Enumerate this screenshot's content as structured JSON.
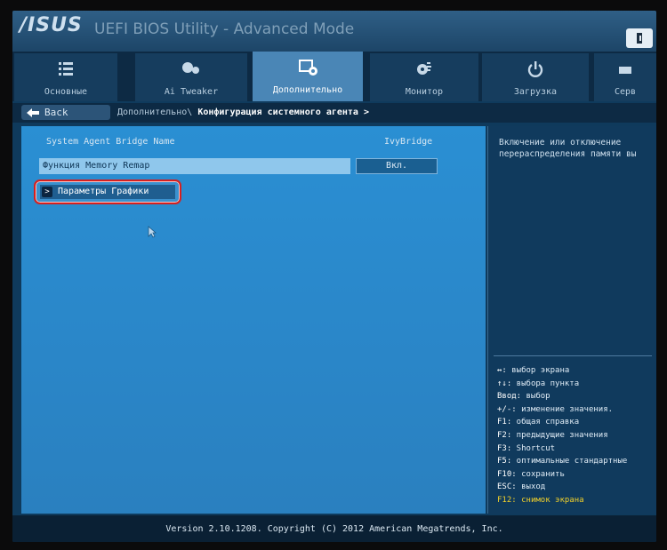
{
  "header": {
    "logo": "/ISUS",
    "title": "UEFI BIOS Utility - Advanced Mode"
  },
  "tabs": [
    {
      "label": "Основные",
      "icon": "list-icon",
      "active": false
    },
    {
      "label": "Ai Tweaker",
      "icon": "tweaker-icon",
      "active": false
    },
    {
      "label": "Дополнительно",
      "icon": "advanced-icon",
      "active": true
    },
    {
      "label": "Монитор",
      "icon": "monitor-icon",
      "active": false
    },
    {
      "label": "Загрузка",
      "icon": "power-icon",
      "active": false
    },
    {
      "label": "Серв",
      "icon": "tool-icon",
      "active": false
    }
  ],
  "nav": {
    "back_label": "Back",
    "crumb_prefix": "Дополнительно\\",
    "crumb_current": "Конфигурация системного агента >"
  },
  "main": {
    "bridge_label": "System Agent Bridge Name",
    "bridge_value": "IvyBridge",
    "memory_remap_label": "Функция Memory Remap",
    "memory_remap_value": "Вкл.",
    "graphics_submenu_label": "Параметры Графики"
  },
  "help": {
    "description": "Включение или отключение перераспределения памяти вы",
    "keys": [
      {
        "key": "↔:",
        "text": " выбор экрана"
      },
      {
        "key": "↑↓:",
        "text": " выбора пункта"
      },
      {
        "key": "Ввод:",
        "text": " выбор"
      },
      {
        "key": "+/-:",
        "text": " изменение значения."
      },
      {
        "key": "F1:",
        "text": " общая справка"
      },
      {
        "key": "F2:",
        "text": " предыдущие значения"
      },
      {
        "key": "F3:",
        "text": " Shortcut"
      },
      {
        "key": "F5:",
        "text": " оптимальные стандартные"
      },
      {
        "key": "F10:",
        "text": " сохранить"
      },
      {
        "key": "ESC:",
        "text": " выход"
      },
      {
        "key": "F12:",
        "text": " снимок экрана"
      }
    ]
  },
  "footer": {
    "version": "Version 2.10.1208. Copyright (C) 2012 American Megatrends, Inc."
  }
}
